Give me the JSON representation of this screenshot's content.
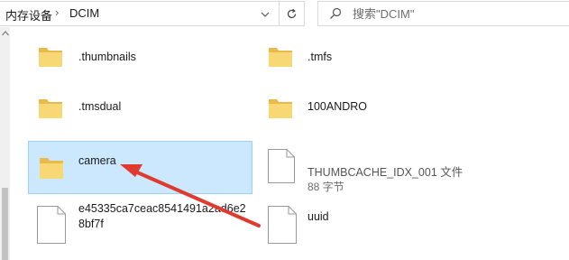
{
  "address": {
    "crumbs": [
      "内存设备",
      "DCIM"
    ],
    "separator": "›"
  },
  "search": {
    "placeholder": "搜索\"DCIM\""
  },
  "items": [
    {
      "name": ".thumbnails",
      "type": "folder"
    },
    {
      "name": ".tmfs",
      "type": "folder"
    },
    {
      "name": ".tmsdual",
      "type": "folder"
    },
    {
      "name": "100ANDRO",
      "type": "folder"
    },
    {
      "name": "camera",
      "type": "folder",
      "selected": true
    },
    {
      "name": "THUMBCACHE_IDX_001 文件",
      "detail": "88 字节",
      "type": "file"
    },
    {
      "name_line1": "e45335ca7ceac8541491a2ad6e2",
      "name_line2": "8bf7f",
      "type": "file"
    },
    {
      "name": "uuid",
      "type": "file"
    }
  ],
  "colors": {
    "selection_bg": "#cce8ff",
    "selection_border": "#99d1ff",
    "folder": "#f8d775",
    "arrow": "#e03a2f"
  },
  "icons": [
    "chevron-down-icon",
    "refresh-icon",
    "search-icon",
    "folder-icon",
    "file-icon",
    "chevron-up-icon"
  ]
}
